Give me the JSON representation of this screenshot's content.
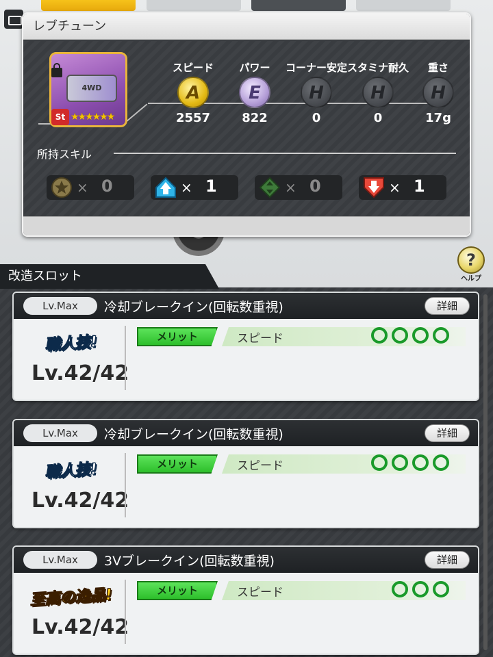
{
  "panel": {
    "title": "レブチューン",
    "part": {
      "logo": "4WD",
      "badge": "St",
      "stars": "★★★★★★"
    },
    "stats": [
      {
        "label": "スピード",
        "grade": "A",
        "value": "2557"
      },
      {
        "label": "パワー",
        "grade": "E",
        "value": "822"
      },
      {
        "label": "コーナー安定",
        "grade": "H",
        "value": "0"
      },
      {
        "label": "スタミナ耐久",
        "grade": "H",
        "value": "0"
      },
      {
        "label": "重さ",
        "grade": "H",
        "value": "17g"
      }
    ],
    "skills_title": "所持スキル",
    "skills": [
      {
        "icon": "star-icon",
        "x": "×",
        "count": "0"
      },
      {
        "icon": "arrow-up-icon",
        "x": "×",
        "count": "1"
      },
      {
        "icon": "diamond-arrows-icon",
        "x": "×",
        "count": "0"
      },
      {
        "icon": "arrow-down-icon",
        "x": "×",
        "count": "1"
      }
    ]
  },
  "help": {
    "label": "ヘルプ",
    "glyph": "?"
  },
  "slot_header": "改造スロット",
  "slots": [
    {
      "lv": "Lv.Max",
      "name": "冷却ブレークイン(回転数重視)",
      "detail": "詳細",
      "badge": "職人技!",
      "level": "Lv.42/42",
      "merit": "メリット",
      "merit_name": "スピード",
      "rank": 4
    },
    {
      "lv": "Lv.Max",
      "name": "冷却ブレークイン(回転数重視)",
      "detail": "詳細",
      "badge": "職人技!",
      "level": "Lv.42/42",
      "merit": "メリット",
      "merit_name": "スピード",
      "rank": 4
    },
    {
      "lv": "Lv.Max",
      "name": "3Vブレークイン(回転数重視)",
      "detail": "詳細",
      "badge": "至高の逸品!",
      "level": "Lv.42/42",
      "merit": "メリット",
      "merit_name": "スピード",
      "rank": 3
    }
  ]
}
